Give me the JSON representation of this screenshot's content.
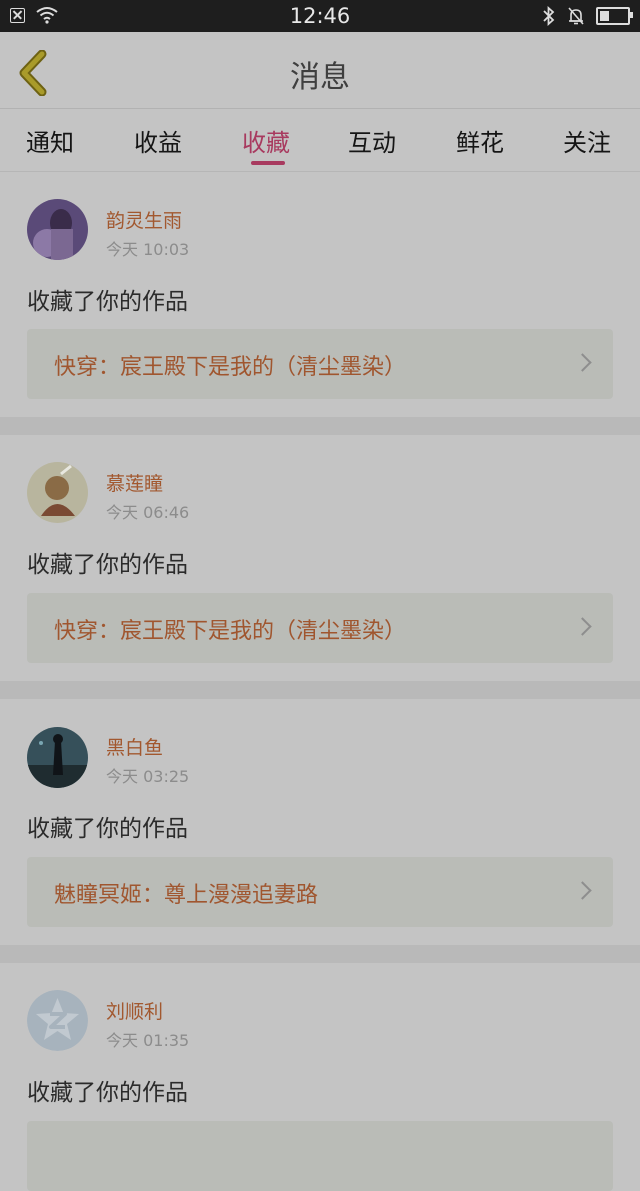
{
  "status_bar": {
    "time": "12:46"
  },
  "header": {
    "title": "消息"
  },
  "tabs": [
    {
      "label": "通知"
    },
    {
      "label": "收益"
    },
    {
      "label": "收藏"
    },
    {
      "label": "互动"
    },
    {
      "label": "鲜花"
    },
    {
      "label": "关注"
    }
  ],
  "active_tab": "收藏",
  "messages": [
    {
      "username": "韵灵生雨",
      "time": "今天 10:03",
      "action": "收藏了你的作品",
      "work_title": "快穿：宸王殿下是我的（清尘墨染）"
    },
    {
      "username": "慕莲瞳",
      "time": "今天 06:46",
      "action": "收藏了你的作品",
      "work_title": "快穿：宸王殿下是我的（清尘墨染）"
    },
    {
      "username": "黑白鱼",
      "time": "今天 03:25",
      "action": "收藏了你的作品",
      "work_title": "魅瞳冥姬：尊上漫漫追妻路"
    },
    {
      "username": "刘顺利",
      "time": "今天 01:35",
      "action": "收藏了你的作品",
      "work_title": ""
    }
  ],
  "colors": {
    "accent": "#a83a5f",
    "username": "#a2582f",
    "overlay_bg": "#c4c4c4"
  }
}
